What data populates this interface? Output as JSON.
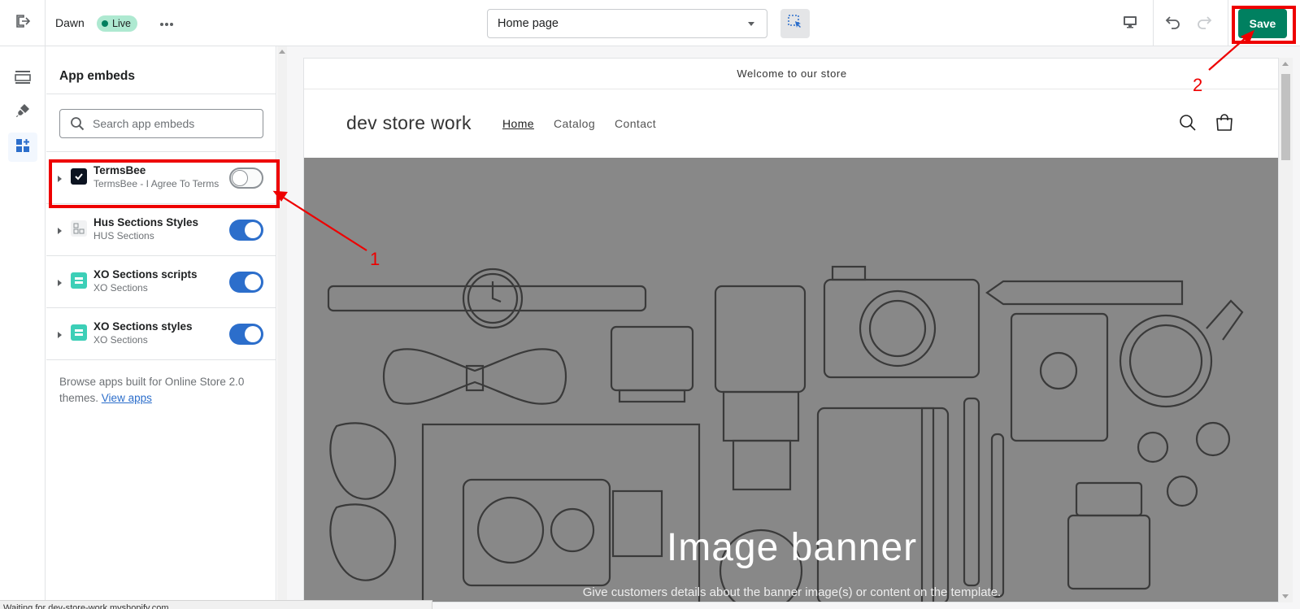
{
  "topbar": {
    "theme_name": "Dawn",
    "live_badge": "Live",
    "page_select_value": "Home page",
    "save_label": "Save",
    "icons": {
      "exit": "exit-icon",
      "more": "more-horizontal-icon",
      "inspect": "inspector-select-icon",
      "device": "desktop-icon",
      "undo": "undo-icon",
      "redo": "redo-icon"
    }
  },
  "rail": {
    "items": [
      {
        "icon": "sections-icon",
        "active": false
      },
      {
        "icon": "theme-settings-paintbrush-icon",
        "active": false
      },
      {
        "icon": "app-embeds-icon",
        "active": true
      }
    ]
  },
  "sidebar": {
    "title": "App embeds",
    "search_placeholder": "Search app embeds",
    "embeds": [
      {
        "name": "TermsBee",
        "sub": "TermsBee - I Agree To Terms",
        "enabled": false
      },
      {
        "name": "Hus Sections Styles",
        "sub": "HUS Sections",
        "enabled": true
      },
      {
        "name": "XO Sections scripts",
        "sub": "XO Sections",
        "enabled": true
      },
      {
        "name": "XO Sections styles",
        "sub": "XO Sections",
        "enabled": true
      }
    ],
    "browse_text": "Browse apps built for Online Store 2.0 themes.",
    "browse_link": "View apps"
  },
  "preview": {
    "announcement": "Welcome to our store",
    "store_name": "dev store work",
    "nav": [
      "Home",
      "Catalog",
      "Contact"
    ],
    "banner_title": "Image banner",
    "banner_subtitle": "Give customers details about the banner image(s) or content on the template."
  },
  "status_bar": "Waiting for dev-store-work.myshopify.com...",
  "annotations": {
    "label_1": "1",
    "label_2": "2",
    "color": "#ee0000"
  },
  "colors": {
    "accent_blue": "#2c6ecb",
    "save_green": "#008060",
    "live_bg": "#aee9d1",
    "banner_gray": "#888888"
  }
}
